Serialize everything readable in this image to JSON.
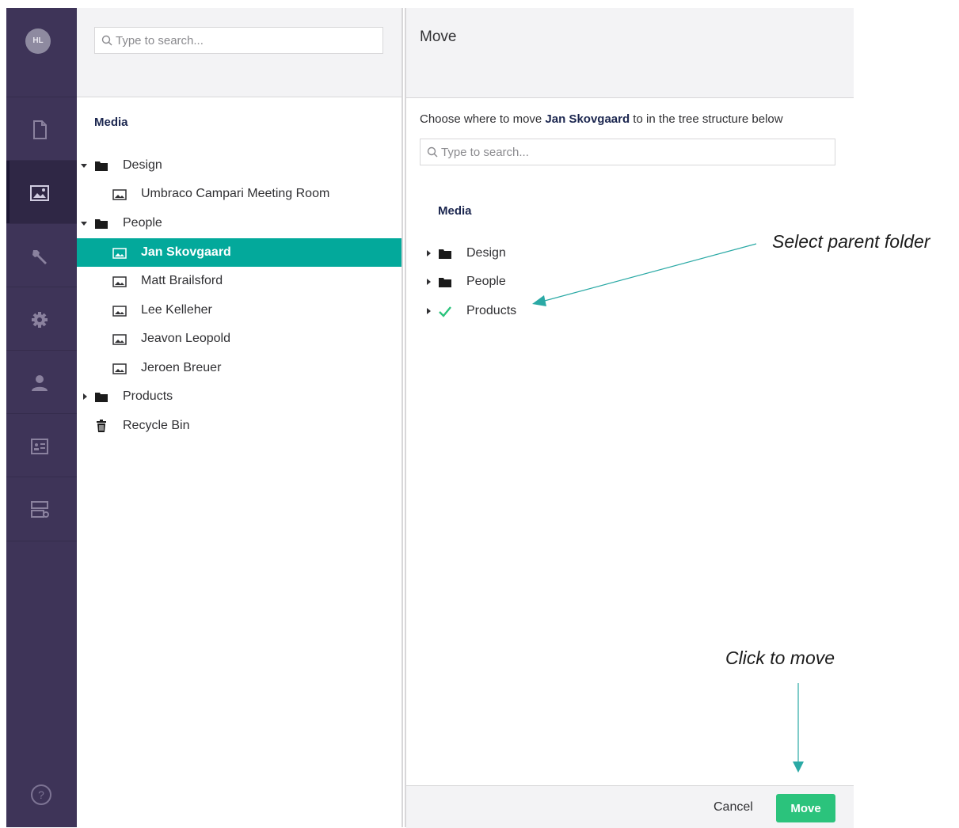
{
  "user": {
    "initials": "HL"
  },
  "sidebar_sections": [
    {
      "icon": "document-icon",
      "name": "content"
    },
    {
      "icon": "image-icon",
      "name": "media",
      "active": true
    },
    {
      "icon": "wrench-icon",
      "name": "settings"
    },
    {
      "icon": "gear-icon",
      "name": "packages"
    },
    {
      "icon": "user-icon",
      "name": "users"
    },
    {
      "icon": "id-card-icon",
      "name": "members"
    },
    {
      "icon": "forms-icon",
      "name": "forms"
    }
  ],
  "tree": {
    "search_placeholder": "Type to search...",
    "title": "Media",
    "items": [
      {
        "label": "Design",
        "type": "folder",
        "expanded": true
      },
      {
        "label": "Umbraco Campari Meeting Room",
        "type": "image"
      },
      {
        "label": "People",
        "type": "folder",
        "expanded": true
      },
      {
        "label": "Jan Skovgaard",
        "type": "image",
        "selected": true
      },
      {
        "label": "Matt Brailsford",
        "type": "image"
      },
      {
        "label": "Lee Kelleher",
        "type": "image"
      },
      {
        "label": "Jeavon Leopold",
        "type": "image"
      },
      {
        "label": "Jeroen Breuer",
        "type": "image"
      },
      {
        "label": "Products",
        "type": "folder",
        "expanded": false
      },
      {
        "label": "Recycle Bin",
        "type": "trash"
      }
    ]
  },
  "move_dialog": {
    "title": "Move",
    "instruction_prefix": "Choose where to move ",
    "instruction_item": "Jan Skovgaard",
    "instruction_suffix": " to in the tree structure below",
    "search_placeholder": "Type to search...",
    "picker_title": "Media",
    "picker_items": [
      {
        "label": "Design",
        "type": "folder"
      },
      {
        "label": "People",
        "type": "folder"
      },
      {
        "label": "Products",
        "type": "checked"
      }
    ],
    "cancel_label": "Cancel",
    "move_label": "Move"
  },
  "annotations": {
    "select_parent": "Select parent folder",
    "click_to_move": "Click to move",
    "arrow_color": "#2aa9a5"
  },
  "colors": {
    "nav_bg": "#3e3458",
    "selected_row": "#03a99b",
    "move_button": "#2bc37c",
    "check": "#2bc37c"
  }
}
